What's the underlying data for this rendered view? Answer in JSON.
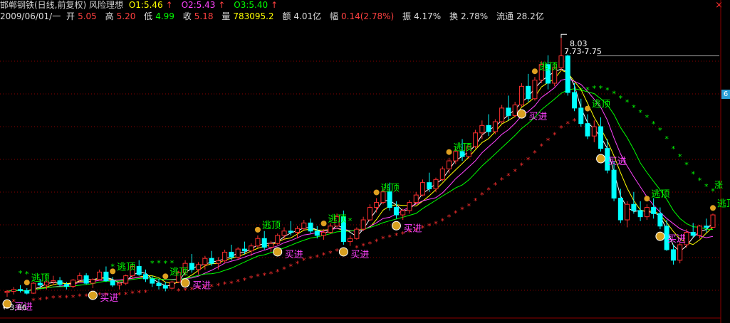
{
  "header": {
    "title": "邯郸钢铁(日线,前复权) 风险理想",
    "o1_label": "O1:5.46",
    "o2_label": "O2:5.43",
    "o3_label": "O3:5.40",
    "arrow": "↑"
  },
  "quote": {
    "date": "2009/06/01/一",
    "open_label": "开",
    "open": "5.05",
    "high_label": "高",
    "high": "5.20",
    "low_label": "低",
    "low": "4.99",
    "close_label": "收",
    "close": "5.18",
    "vol_label": "量",
    "vol": "783095.2",
    "amt_label": "额",
    "amt": "4.01亿",
    "chg_label": "幅",
    "chg": "0.14(2.78%)",
    "amp_label": "振",
    "amp": "4.17%",
    "turn_label": "换",
    "turn": "2.78%",
    "float_label": "流通",
    "float": "28.2亿"
  },
  "close_button": "×",
  "right_tag": "6",
  "colors": {
    "up": "#ff3030",
    "down": "#00ffff",
    "sar": "#ff3030",
    "sar_high": "#00ff00",
    "ma_white": "#ffffff",
    "ma_yellow": "#ffff00",
    "ma_magenta": "#ff44ff",
    "ma_green": "#00ff00",
    "grid": "#8b0000",
    "buy_text": "#ff44ff",
    "sell_text": "#00ff00"
  },
  "chart_data": {
    "type": "candlestick",
    "title": "邯郸钢铁(日线,前复权) 风险理想",
    "ylim": [
      3.6,
      8.25
    ],
    "high_marker": "8.03",
    "high_range": "7.73-7.75",
    "low_marker": "←3.86",
    "end_label": "涨",
    "signal_buy": "买进",
    "signal_sell": "逃顶",
    "candles": [
      [
        3.93,
        3.97,
        3.86,
        3.95
      ],
      [
        3.95,
        4.02,
        3.9,
        3.98
      ],
      [
        3.98,
        4.05,
        3.93,
        3.96
      ],
      [
        3.96,
        4.0,
        3.9,
        3.92
      ],
      [
        3.92,
        4.1,
        3.91,
        4.08
      ],
      [
        4.08,
        4.15,
        4.0,
        4.05
      ],
      [
        4.05,
        4.12,
        3.98,
        4.1
      ],
      [
        4.1,
        4.2,
        4.05,
        4.12
      ],
      [
        4.12,
        4.18,
        4.02,
        4.06
      ],
      [
        4.06,
        4.1,
        3.98,
        4.03
      ],
      [
        4.03,
        4.15,
        4.0,
        4.13
      ],
      [
        4.13,
        4.25,
        4.1,
        4.2
      ],
      [
        4.2,
        4.24,
        4.06,
        4.08
      ],
      [
        4.08,
        4.16,
        4.0,
        4.14
      ],
      [
        4.14,
        4.3,
        4.12,
        4.26
      ],
      [
        4.26,
        4.35,
        4.1,
        4.12
      ],
      [
        4.12,
        4.18,
        4.02,
        4.05
      ],
      [
        4.05,
        4.1,
        3.98,
        4.08
      ],
      [
        4.08,
        4.22,
        4.05,
        4.2
      ],
      [
        4.2,
        4.4,
        4.15,
        4.35
      ],
      [
        4.35,
        4.45,
        4.2,
        4.22
      ],
      [
        4.22,
        4.3,
        4.1,
        4.15
      ],
      [
        4.15,
        4.2,
        4.02,
        4.08
      ],
      [
        4.08,
        4.15,
        3.98,
        4.04
      ],
      [
        4.04,
        4.1,
        3.95,
        4.0
      ],
      [
        4.0,
        4.12,
        3.98,
        4.1
      ],
      [
        4.1,
        4.28,
        4.08,
        4.25
      ],
      [
        4.25,
        4.45,
        4.2,
        4.4
      ],
      [
        4.4,
        4.55,
        4.25,
        4.3
      ],
      [
        4.3,
        4.42,
        4.22,
        4.38
      ],
      [
        4.38,
        4.52,
        4.3,
        4.48
      ],
      [
        4.48,
        4.6,
        4.36,
        4.4
      ],
      [
        4.4,
        4.5,
        4.3,
        4.44
      ],
      [
        4.44,
        4.62,
        4.4,
        4.58
      ],
      [
        4.58,
        4.7,
        4.45,
        4.5
      ],
      [
        4.5,
        4.66,
        4.46,
        4.63
      ],
      [
        4.63,
        4.75,
        4.55,
        4.6
      ],
      [
        4.6,
        4.72,
        4.52,
        4.68
      ],
      [
        4.68,
        4.85,
        4.65,
        4.8
      ],
      [
        4.8,
        4.92,
        4.62,
        4.66
      ],
      [
        4.66,
        4.76,
        4.58,
        4.72
      ],
      [
        4.72,
        4.88,
        4.7,
        4.85
      ],
      [
        4.85,
        4.98,
        4.78,
        4.92
      ],
      [
        4.92,
        5.08,
        4.85,
        4.9
      ],
      [
        4.9,
        5.0,
        4.8,
        4.96
      ],
      [
        4.96,
        5.1,
        4.92,
        5.05
      ],
      [
        5.05,
        5.12,
        4.88,
        4.92
      ],
      [
        4.92,
        5.0,
        4.8,
        4.85
      ],
      [
        4.85,
        4.95,
        4.78,
        4.9
      ],
      [
        4.9,
        5.05,
        4.88,
        5.0
      ],
      [
        5.0,
        5.2,
        4.98,
        5.15
      ],
      [
        5.15,
        5.25,
        4.7,
        4.75
      ],
      [
        4.75,
        4.85,
        4.68,
        4.8
      ],
      [
        4.8,
        4.98,
        4.78,
        4.95
      ],
      [
        4.95,
        5.15,
        4.92,
        5.1
      ],
      [
        5.1,
        5.35,
        5.08,
        5.3
      ],
      [
        5.3,
        5.45,
        5.22,
        5.38
      ],
      [
        5.38,
        5.6,
        5.35,
        5.55
      ],
      [
        5.55,
        5.7,
        5.25,
        5.3
      ],
      [
        5.3,
        5.4,
        5.12,
        5.18
      ],
      [
        5.18,
        5.28,
        5.1,
        5.25
      ],
      [
        5.25,
        5.42,
        5.2,
        5.38
      ],
      [
        5.38,
        5.55,
        5.35,
        5.5
      ],
      [
        5.5,
        5.75,
        5.48,
        5.7
      ],
      [
        5.7,
        5.86,
        5.55,
        5.6
      ],
      [
        5.6,
        5.78,
        5.55,
        5.75
      ],
      [
        5.75,
        5.96,
        5.72,
        5.92
      ],
      [
        5.92,
        6.1,
        5.85,
        6.05
      ],
      [
        6.05,
        6.25,
        6.0,
        6.2
      ],
      [
        6.2,
        6.4,
        6.05,
        6.12
      ],
      [
        6.12,
        6.3,
        6.08,
        6.28
      ],
      [
        6.28,
        6.55,
        6.25,
        6.5
      ],
      [
        6.5,
        6.7,
        6.4,
        6.62
      ],
      [
        6.62,
        6.8,
        6.45,
        6.52
      ],
      [
        6.52,
        6.72,
        6.48,
        6.68
      ],
      [
        6.68,
        6.95,
        6.65,
        6.9
      ],
      [
        6.9,
        7.1,
        6.7,
        6.78
      ],
      [
        6.78,
        7.0,
        6.75,
        6.95
      ],
      [
        6.95,
        7.3,
        6.92,
        7.25
      ],
      [
        7.25,
        7.45,
        7.0,
        7.05
      ],
      [
        7.05,
        7.4,
        7.02,
        7.35
      ],
      [
        7.35,
        7.65,
        7.3,
        7.6
      ],
      [
        7.6,
        7.75,
        7.2,
        7.3
      ],
      [
        7.3,
        7.6,
        7.25,
        7.55
      ],
      [
        7.55,
        8.03,
        7.5,
        7.74
      ],
      [
        7.74,
        7.76,
        7.1,
        7.15
      ],
      [
        7.15,
        7.3,
        6.85,
        6.9
      ],
      [
        6.9,
        7.05,
        6.6,
        6.65
      ],
      [
        6.65,
        6.8,
        6.4,
        6.45
      ],
      [
        6.45,
        6.7,
        6.35,
        6.6
      ],
      [
        6.6,
        6.75,
        6.2,
        6.25
      ],
      [
        6.25,
        6.4,
        5.85,
        5.9
      ],
      [
        5.9,
        6.05,
        5.4,
        5.45
      ],
      [
        5.45,
        5.6,
        5.05,
        5.1
      ],
      [
        5.1,
        5.4,
        4.98,
        5.35
      ],
      [
        5.35,
        5.55,
        5.2,
        5.25
      ],
      [
        5.25,
        5.4,
        5.08,
        5.15
      ],
      [
        5.15,
        5.35,
        5.1,
        5.3
      ],
      [
        5.3,
        5.45,
        5.12,
        5.2
      ],
      [
        5.2,
        5.3,
        4.95,
        5.0
      ],
      [
        5.0,
        5.1,
        4.6,
        4.62
      ],
      [
        4.62,
        4.7,
        4.38,
        4.45
      ],
      [
        4.45,
        4.75,
        4.4,
        4.7
      ],
      [
        4.7,
        4.95,
        4.65,
        4.9
      ],
      [
        4.9,
        5.05,
        4.82,
        4.85
      ],
      [
        4.85,
        5.02,
        4.8,
        5.0
      ],
      [
        5.0,
        5.12,
        4.9,
        4.98
      ],
      [
        4.98,
        5.2,
        4.99,
        5.18
      ]
    ],
    "buy_signals": [
      0,
      13,
      27,
      41,
      51,
      59,
      78,
      90,
      99
    ],
    "sell_signals": [
      3,
      16,
      24,
      38,
      48,
      56,
      67,
      80,
      88,
      97,
      107
    ]
  }
}
